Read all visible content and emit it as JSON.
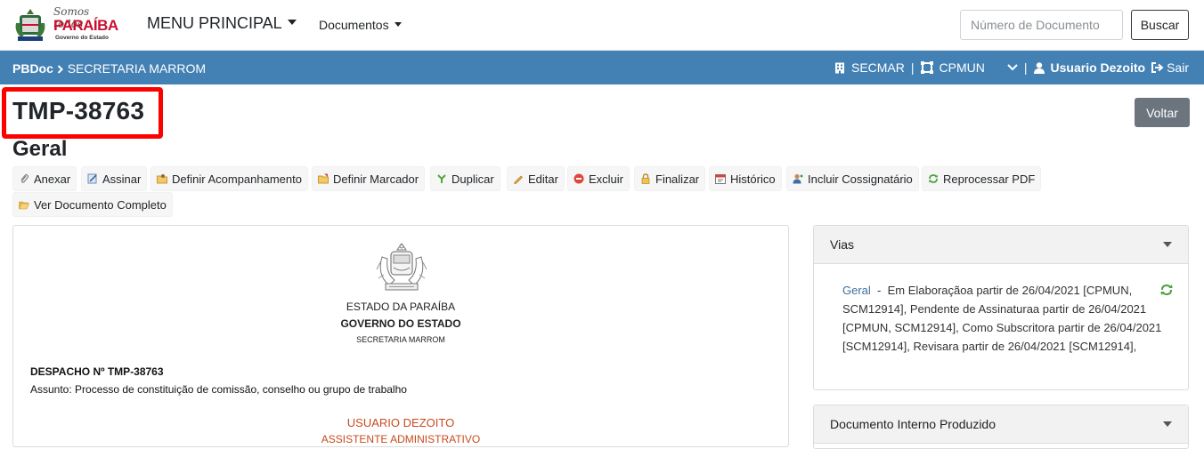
{
  "header": {
    "logo": {
      "line1": "Somos todos",
      "line2": "PARAÍBA",
      "line3": "Governo do Estado"
    },
    "menu_principal": "MENU PRINCIPAL",
    "menu_documentos": "Documentos",
    "search_placeholder": "Número de Documento",
    "search_button": "Buscar"
  },
  "bar": {
    "crumb_root": "PBDoc",
    "crumb_current": "SECRETARIA MARROM",
    "org": "SECMAR",
    "unit": "CPMUN",
    "user": "Usuario Dezoito",
    "logout": "Sair"
  },
  "page": {
    "doc_code": "TMP-38763",
    "subtitle": "Geral",
    "back_button": "Voltar"
  },
  "actions": [
    {
      "label": "Anexar",
      "icon": "paperclip-icon"
    },
    {
      "label": "Assinar",
      "icon": "sign-icon"
    },
    {
      "label": "Definir Acompanhamento",
      "icon": "folder-user-icon"
    },
    {
      "label": "Definir Marcador",
      "icon": "folder-tag-icon"
    },
    {
      "label": "Duplicar",
      "icon": "fork-icon"
    },
    {
      "label": "Editar",
      "icon": "pencil-icon"
    },
    {
      "label": "Excluir",
      "icon": "delete-icon"
    },
    {
      "label": "Finalizar",
      "icon": "lock-icon"
    },
    {
      "label": "Histórico",
      "icon": "calendar-icon"
    },
    {
      "label": "Incluir Cossignatário",
      "icon": "user-add-icon"
    },
    {
      "label": "Reprocessar PDF",
      "icon": "recycle-icon"
    },
    {
      "label": "Ver Documento Completo",
      "icon": "folder-open-icon"
    }
  ],
  "document": {
    "state": "ESTADO DA PARAÍBA",
    "government": "GOVERNO DO ESTADO",
    "secretariat": "SECRETARIA MARROM",
    "despacho": "DESPACHO Nº TMP-38763",
    "assunto": "Assunto: Processo de constituição de comissão, conselho ou grupo de trabalho",
    "signer_name": "USUARIO DEZOITO",
    "signer_role": "ASSISTENTE ADMINISTRATIVO"
  },
  "vias": {
    "title": "Vias",
    "link": "Geral",
    "dash": "-",
    "text": "Em Elaboraçãoa partir de 26/04/2021 [CPMUN, SCM12914], Pendente de Assinaturaa partir de 26/04/2021 [CPMUN, SCM12914], Como Subscritora partir de 26/04/2021 [SCM12914], Revisara partir de 26/04/2021 [SCM12914],"
  },
  "produced": {
    "title": "Documento Interno Produzido"
  },
  "colors": {
    "bar": "#4381b5",
    "highlight": "#ff0000",
    "back_button": "#6c757d",
    "signer": "#c84a1e"
  }
}
